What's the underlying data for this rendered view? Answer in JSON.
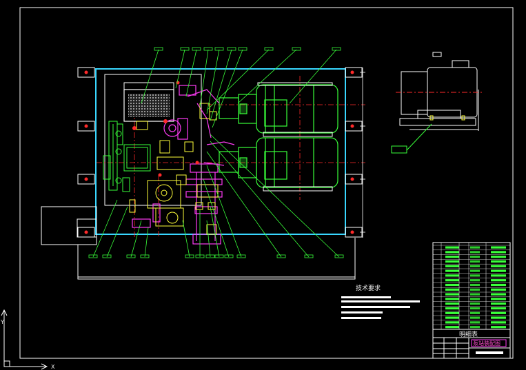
{
  "drawing": {
    "tech_requirements_heading": "技术要求",
    "parts_list_title": "明细表",
    "title_block_name": "泵站装配图",
    "ucs_axis_x": "X",
    "ucs_axis_y": "Y"
  },
  "colors": {
    "background": "#000000",
    "frame": "#ffffff",
    "cyan": "#39d7ff",
    "green": "#39ff3a",
    "magenta": "#ff3bf5",
    "yellow": "#ffff3a",
    "red": "#ff2a2a",
    "white": "#ffffff"
  }
}
